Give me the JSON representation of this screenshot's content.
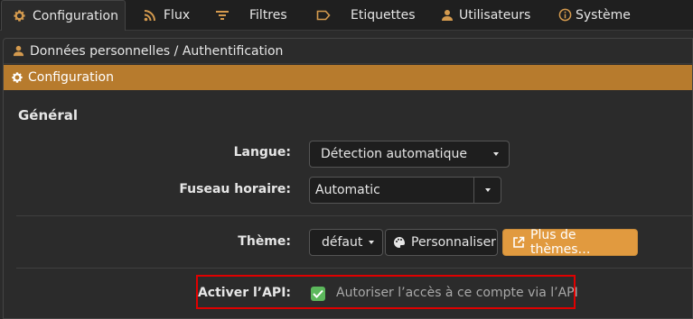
{
  "tabs": [
    {
      "label": "Configuration",
      "icon": "gear-icon",
      "active": true
    },
    {
      "label": "Flux",
      "icon": "rss-icon"
    },
    {
      "label": "Filtres",
      "icon": "filter-icon"
    },
    {
      "label": "Etiquettes",
      "icon": "label-icon"
    },
    {
      "label": "Utilisateurs",
      "icon": "user-icon"
    },
    {
      "label": "Système",
      "icon": "info-icon"
    }
  ],
  "panel": {
    "header": "Données personnelles / Authentification",
    "section": "Configuration"
  },
  "general": {
    "title": "Général",
    "langue_label": "Langue:",
    "langue_value": "Détection automatique",
    "fuseau_label": "Fuseau horaire:",
    "fuseau_value": "Automatic",
    "theme_label": "Thème:",
    "theme_value": "défaut",
    "personnaliser_label": "Personnaliser",
    "plus_themes_label": "Plus de thèmes…",
    "api_label": "Activer l’API:",
    "api_checkbox_label": "Autoriser l’accès à ce compte via l’API",
    "api_checked": true
  },
  "colors": {
    "accent": "#b77b2d",
    "button_orange": "#e19a3f",
    "highlight": "#e00000",
    "checkbox": "#5cb85c"
  }
}
